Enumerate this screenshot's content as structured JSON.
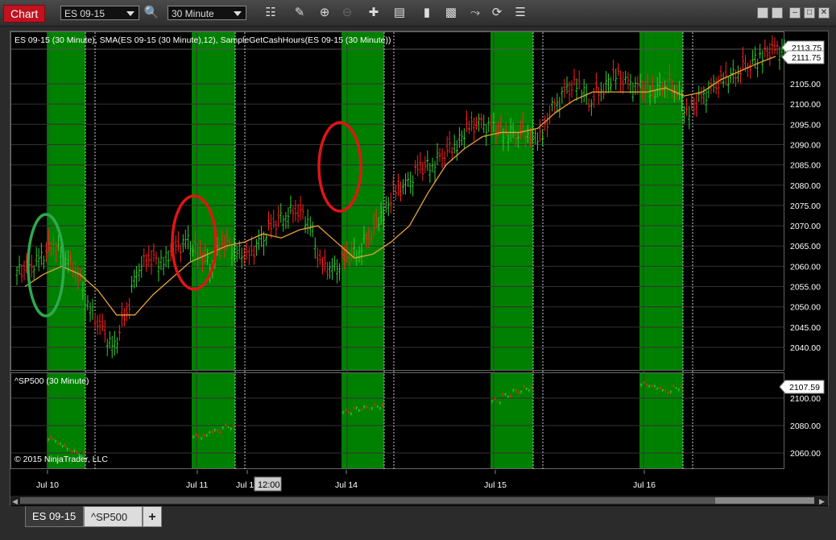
{
  "toolbar": {
    "chart_label": "Chart",
    "instrument": "ES 09-15",
    "interval": "30 Minute",
    "icons": [
      "search-icon",
      "bar-style-icon",
      "pencil-icon",
      "zoom-in-icon",
      "zoom-out-icon",
      "crosshair-icon",
      "data-box-icon",
      "bar-type-icon",
      "order-icon",
      "strategy-icon",
      "reload-icon",
      "properties-icon"
    ]
  },
  "window_controls": [
    "grid-layout-icon",
    "tile-icon",
    "minimize-icon",
    "maximize-icon",
    "close-icon"
  ],
  "panel_top": {
    "title": "ES 09-15 (30 Minute), SMA(ES 09-15 (30 Minute),12), SampleGetCashHours(ES 09-15 (30 Minute))",
    "price_labels": [
      "2105.00",
      "2100.00",
      "2095.00",
      "2090.00",
      "2085.00",
      "2080.00",
      "2075.00",
      "2070.00",
      "2065.00",
      "2060.00",
      "2055.00",
      "2050.00",
      "2045.00",
      "2040.00"
    ],
    "last_price": "2113.75",
    "last_price2": "2111.75",
    "chart_data": {
      "type": "ohlc",
      "series": [
        {
          "name": "ES 09-15 (30 Minute)",
          "values": [
            2059,
            2062,
            2065,
            2063,
            2058,
            2050,
            2044,
            2040,
            2048,
            2060,
            2062,
            2061,
            2064,
            2066,
            2063,
            2061,
            2066,
            2064,
            2062,
            2066,
            2070,
            2073,
            2074,
            2071,
            2060,
            2059,
            2062,
            2064,
            2068,
            2073,
            2078,
            2080,
            2084,
            2085,
            2088,
            2090,
            2094,
            2095,
            2094,
            2093,
            2093,
            2093,
            2092,
            2099,
            2103,
            2105,
            2101,
            2104,
            2107,
            2105,
            2104,
            2103,
            2105,
            2104,
            2098,
            2101,
            2104,
            2106,
            2108,
            2110,
            2112,
            2113,
            2113.75
          ]
        },
        {
          "name": "SMA(ES 09-15 (30 Minute),12)",
          "values": [
            2055,
            2058,
            2060,
            2058,
            2054,
            2048,
            2048,
            2053,
            2057,
            2061,
            2063,
            2065,
            2066,
            2068,
            2067,
            2069,
            2070,
            2066,
            2062,
            2063,
            2066,
            2070,
            2078,
            2085,
            2089,
            2092,
            2093,
            2093,
            2094,
            2098,
            2101,
            2103,
            2103,
            2103,
            2103,
            2104,
            2102,
            2103,
            2106,
            2108,
            2110,
            2111.75
          ]
        }
      ],
      "categories": [
        "Jul 10",
        "Jul 11",
        "Jul 13",
        "Jul 14",
        "Jul 15",
        "Jul 16"
      ],
      "ylim": [
        2036,
        2114
      ]
    },
    "highlight_colors": {
      "session": "#008000",
      "up": "#32cd32",
      "down": "#ff2020",
      "sma": "#e8a33a",
      "circle_green": "#2fa84f",
      "circle_red": "#e01515"
    }
  },
  "panel_bottom": {
    "title": "^SP500 (30 Minute)",
    "price_labels": [
      "2100.00",
      "2080.00",
      "2060.00"
    ],
    "last_price": "2107.59",
    "copyright": "© 2015 NinjaTrader, LLC",
    "chart_data": {
      "type": "ohlc",
      "series": [
        {
          "name": "^SP500 (30 Minute)",
          "values": [
            2070,
            2066,
            2062,
            2059,
            2072,
            2076,
            2079,
            2090,
            2092,
            2093,
            2094,
            2098,
            2102,
            2105,
            2107,
            2110,
            2108,
            2105,
            2107.59
          ]
        }
      ],
      "ylim": [
        2048,
        2114
      ]
    }
  },
  "time_axis": {
    "labels": [
      "Jul 10",
      "Jul 11",
      "Jul 1",
      "Jul 14",
      "Jul 15",
      "Jul 16"
    ],
    "cursor_label": "12:00"
  },
  "tabs": [
    {
      "label": "ES 09-15",
      "active": true
    },
    {
      "label": "^SP500",
      "active": false
    }
  ],
  "add_tab_label": "+"
}
